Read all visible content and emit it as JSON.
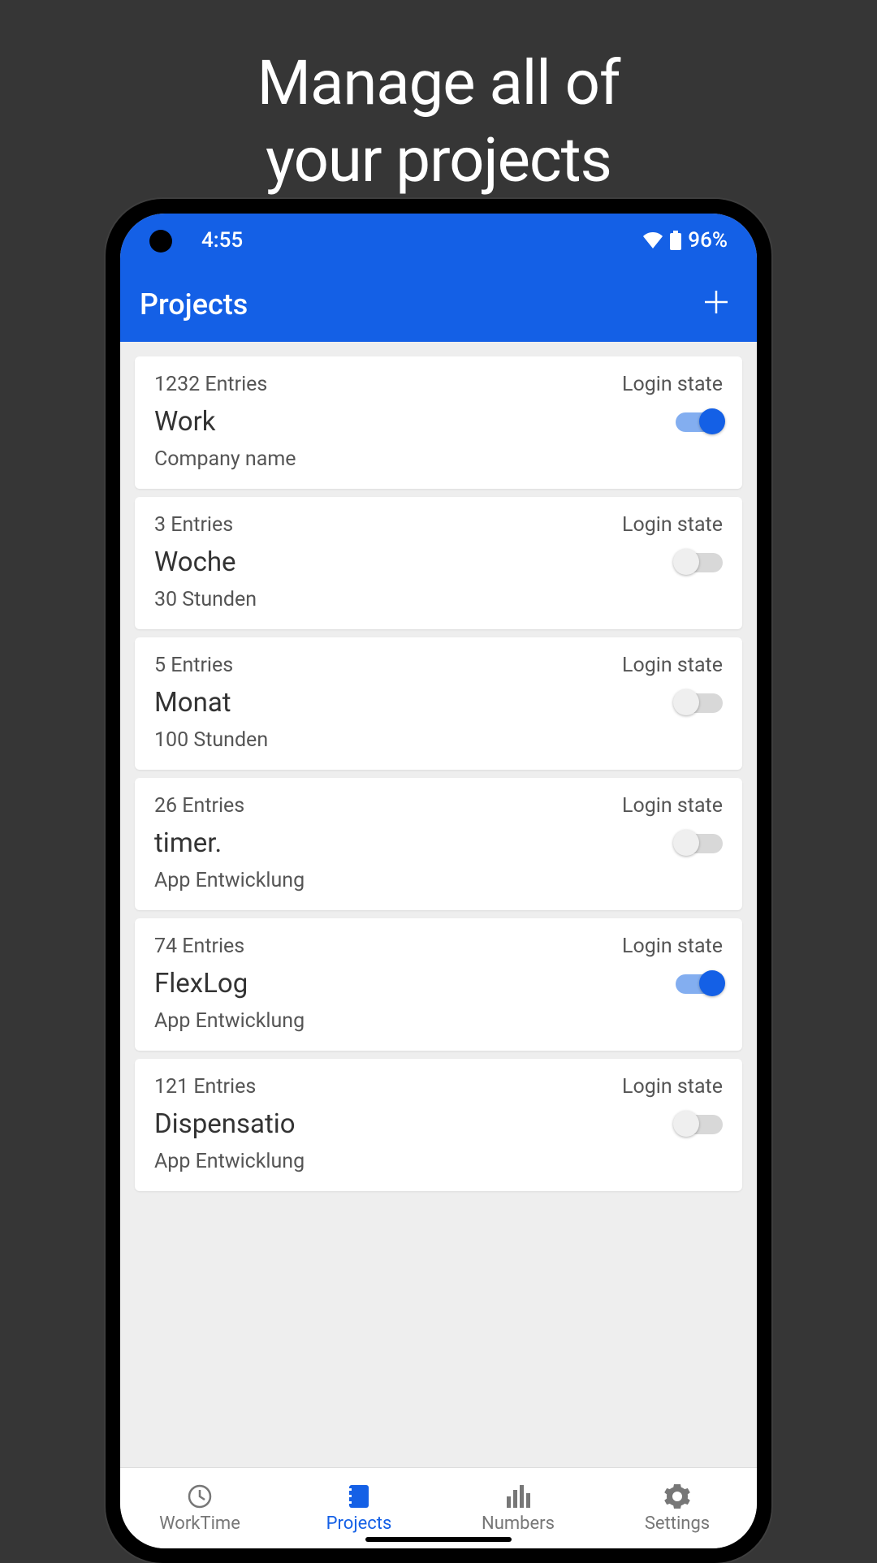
{
  "promo": {
    "line1": "Manage all of",
    "line2": "your projects"
  },
  "status": {
    "time": "4:55",
    "battery": "96%"
  },
  "header": {
    "title": "Projects"
  },
  "login_state_label": "Login state",
  "projects": [
    {
      "entries": "1232 Entries",
      "name": "Work",
      "subtitle": "Company name",
      "on": true
    },
    {
      "entries": "3 Entries",
      "name": "Woche",
      "subtitle": "30 Stunden",
      "on": false
    },
    {
      "entries": "5 Entries",
      "name": "Monat",
      "subtitle": "100 Stunden",
      "on": false
    },
    {
      "entries": "26 Entries",
      "name": "timer.",
      "subtitle": "App Entwicklung",
      "on": false
    },
    {
      "entries": "74 Entries",
      "name": "FlexLog",
      "subtitle": "App Entwicklung",
      "on": true
    },
    {
      "entries": "121 Entries",
      "name": "Dispensatio",
      "subtitle": "App Entwicklung",
      "on": false
    }
  ],
  "nav": {
    "worktime": "WorkTime",
    "projects": "Projects",
    "numbers": "Numbers",
    "settings": "Settings"
  }
}
